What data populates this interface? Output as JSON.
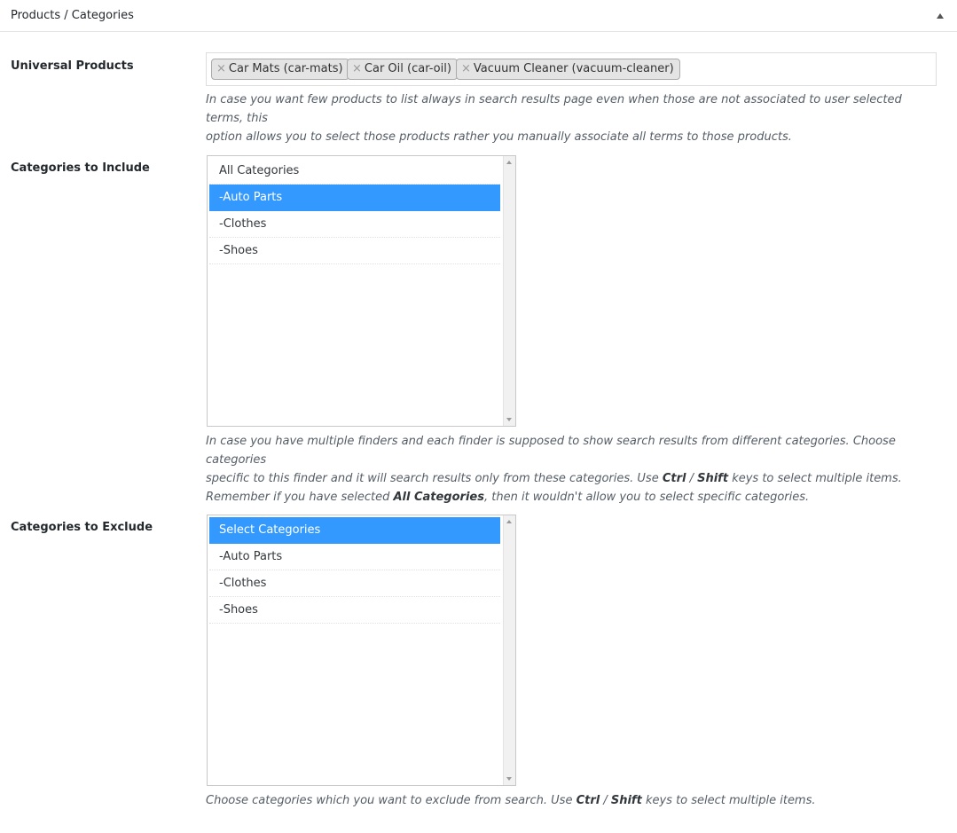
{
  "panel": {
    "title": "Products / Categories",
    "toggle_icon": "triangle-up-icon"
  },
  "universal": {
    "label": "Universal Products",
    "tags": [
      {
        "remove": "×",
        "text": "Car Mats (car-mats)"
      },
      {
        "remove": "×",
        "text": "Car Oil (car-oil)"
      },
      {
        "remove": "×",
        "text": "Vacuum Cleaner (vacuum-cleaner)"
      }
    ],
    "desc_1": "In case you want few products to list always in search results page even when those are not associated to user selected terms, this",
    "desc_2": "option allows you to select those products rather you manually associate all terms to those products."
  },
  "include": {
    "label": "Categories to Include",
    "options": [
      "All Categories",
      "-Auto Parts",
      "-Clothes",
      "-Shoes"
    ],
    "selected": "-Auto Parts",
    "desc_line1": "In case you have multiple finders and each finder is supposed to show search results from different categories. Choose categories",
    "desc_line2_a": "specific to this finder and it will search results only from these categories. Use ",
    "desc_ctrl": "Ctrl",
    "desc_sep": " / ",
    "desc_shift": "Shift",
    "desc_line2_b": " keys to select multiple items.",
    "desc_line3_a": "Remember if you have selected ",
    "desc_all": "All Categories",
    "desc_line3_b": ", then it wouldn't allow you to select specific categories."
  },
  "exclude": {
    "label": "Categories to Exclude",
    "options": [
      "Select Categories",
      "-Auto Parts",
      "-Clothes",
      "-Shoes"
    ],
    "selected": "Select Categories",
    "desc_a": "Choose categories which you want to exclude from search. Use ",
    "desc_ctrl": "Ctrl",
    "desc_sep": " / ",
    "desc_shift": "Shift",
    "desc_b": " keys to select multiple items."
  },
  "colors": {
    "selected_bg": "#3399ff",
    "tag_bg": "#e4e4e4"
  }
}
